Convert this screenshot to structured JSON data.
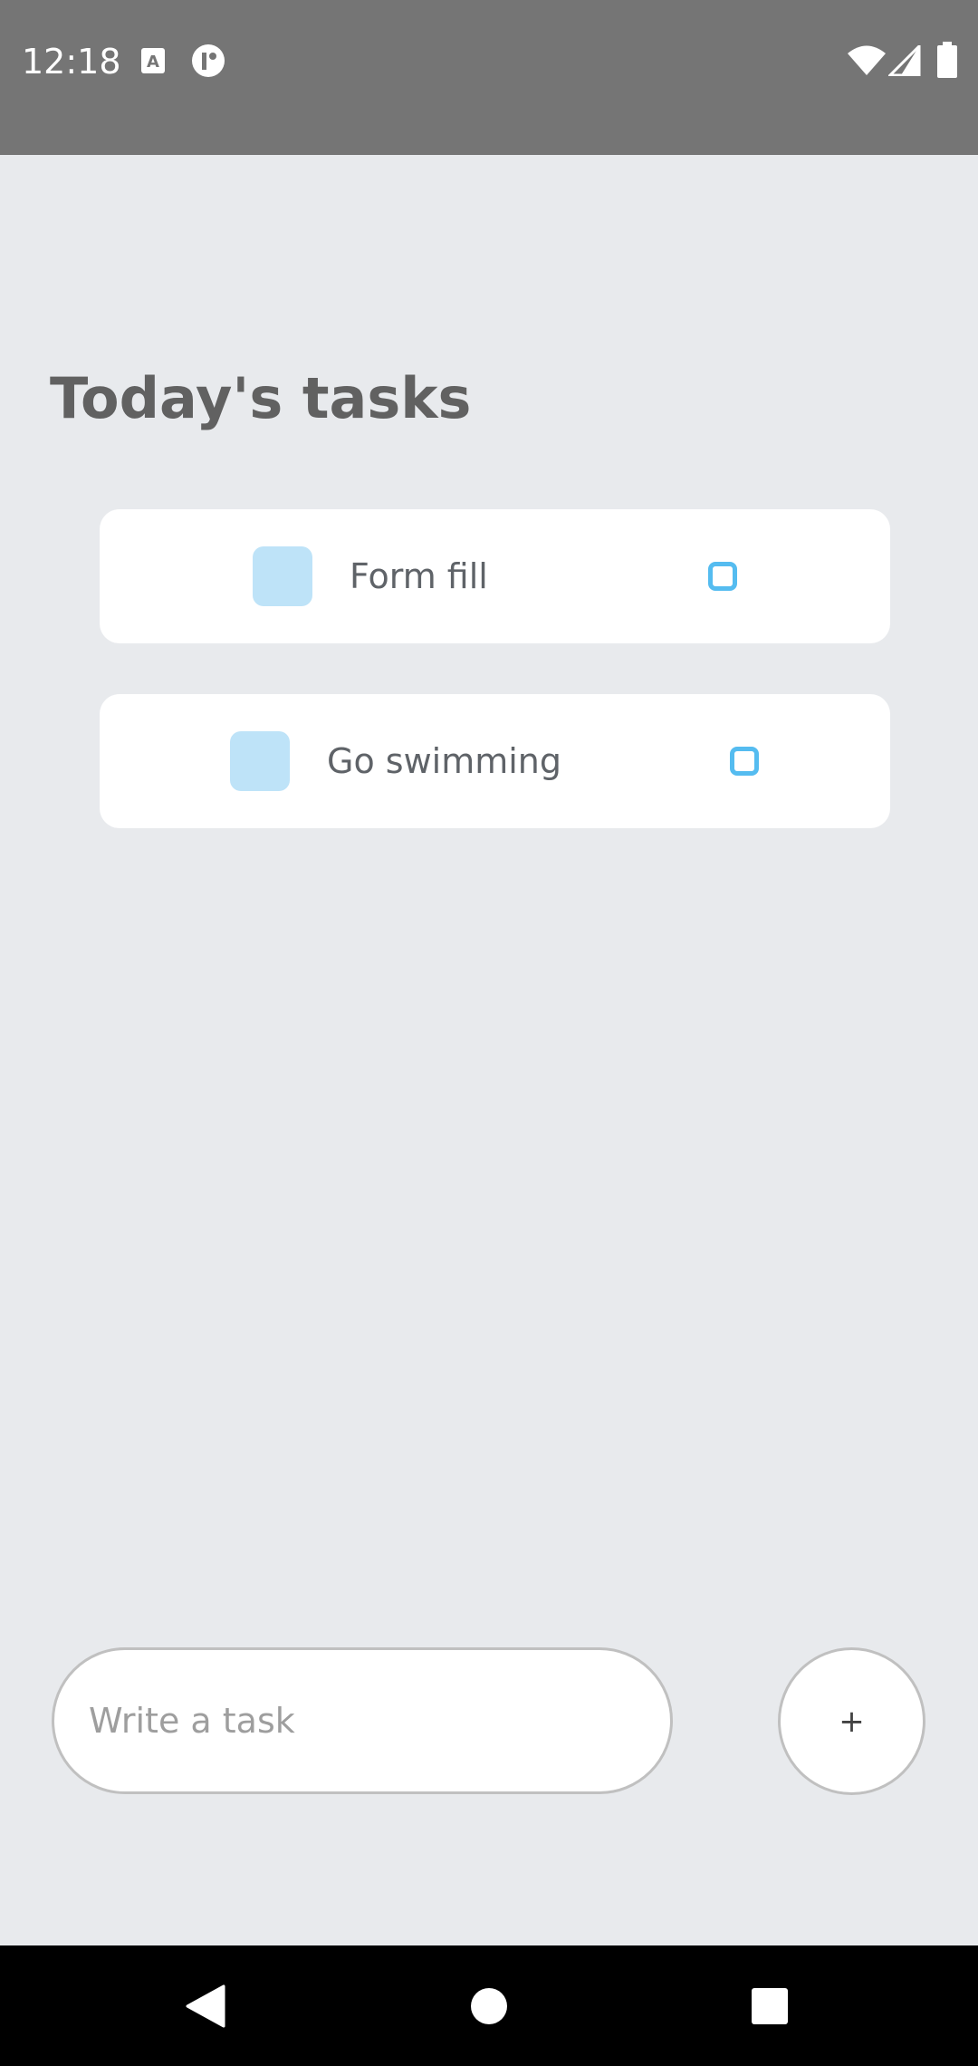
{
  "status_bar": {
    "time": "12:18",
    "icons": [
      "keyboard-a-icon",
      "notification-badge-icon",
      "wifi-icon",
      "signal-icon",
      "battery-icon"
    ]
  },
  "page": {
    "title": "Today's tasks"
  },
  "tasks": [
    {
      "label": "Form fill",
      "checked": false,
      "status": "pending"
    },
    {
      "label": "Go swimming",
      "checked": false,
      "status": "pending"
    }
  ],
  "composer": {
    "placeholder": "Write a task",
    "value": "",
    "add_label": "+"
  },
  "nav": {
    "buttons": [
      "back",
      "home",
      "recents"
    ]
  },
  "colors": {
    "background": "#e8eaed",
    "status_bar": "#757575",
    "checkbox": "#bee3f8",
    "status_accent": "#55bcf0",
    "title": "#616161"
  }
}
